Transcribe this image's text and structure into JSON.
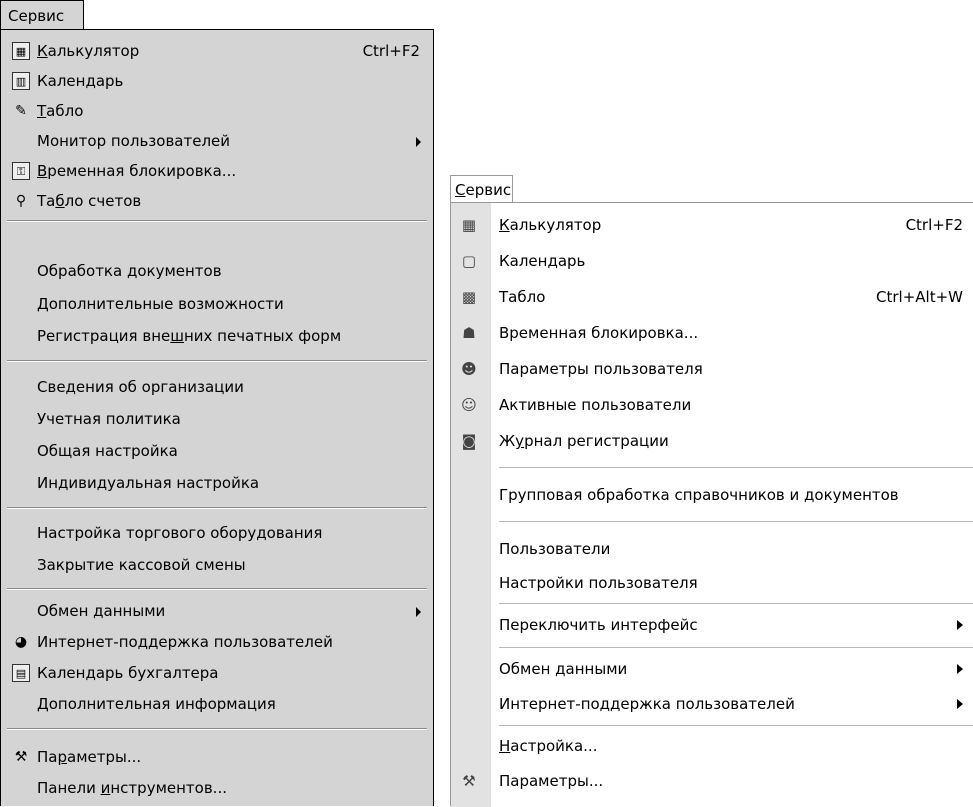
{
  "menu1": {
    "title": "Сервис",
    "items": [
      {
        "icon": "calculator-icon",
        "pre": "",
        "u": "К",
        "post": "алькулятор",
        "shortcut": "Ctrl+F2"
      },
      {
        "icon": "calendar-icon",
        "pre": "Кален",
        "u": "д",
        "post": "арь"
      },
      {
        "icon": "board-icon",
        "pre": "",
        "u": "Т",
        "post": "абло"
      },
      {
        "icon": "",
        "pre": "Монитор пользователей",
        "u": "",
        "post": "",
        "submenu": true
      },
      {
        "icon": "lock-icon",
        "pre": "",
        "u": "В",
        "post": "ременная блокировка..."
      },
      {
        "icon": "accounts-board-icon",
        "pre": "Та",
        "u": "б",
        "post": "ло счетов"
      },
      {
        "icon": "",
        "pre": "Обработка документов",
        "u": "",
        "post": ""
      },
      {
        "icon": "",
        "pre": "Дополнительные возможности",
        "u": "",
        "post": ""
      },
      {
        "icon": "",
        "pre": "Регистрация вне",
        "u": "ш",
        "post": "них печатных форм"
      },
      {
        "icon": "",
        "pre": "Сведения об организации",
        "u": "",
        "post": ""
      },
      {
        "icon": "",
        "pre": "Учетная политика",
        "u": "",
        "post": ""
      },
      {
        "icon": "",
        "pre": "Общая настройка",
        "u": "",
        "post": ""
      },
      {
        "icon": "",
        "pre": "Индивидуальная настройка",
        "u": "",
        "post": ""
      },
      {
        "icon": "",
        "pre": "Настройка торгового оборудования",
        "u": "",
        "post": ""
      },
      {
        "icon": "",
        "pre": "Закрытие кассовой смены",
        "u": "",
        "post": ""
      },
      {
        "icon": "",
        "pre": "Обмен данными",
        "u": "",
        "post": "",
        "submenu": true
      },
      {
        "icon": "internet-support-icon",
        "pre": "Интернет-поддержка пользователей",
        "u": "",
        "post": ""
      },
      {
        "icon": "accountant-calendar-icon",
        "pre": "Календарь бухгалтера",
        "u": "",
        "post": ""
      },
      {
        "icon": "",
        "pre": "Дополнительная информация",
        "u": "",
        "post": ""
      },
      {
        "icon": "tools-icon",
        "pre": "Па",
        "u": "р",
        "post": "аметры..."
      },
      {
        "icon": "",
        "pre": "Панели ",
        "u": "и",
        "post": "нструментов..."
      }
    ]
  },
  "menu2": {
    "title_u": "С",
    "title_rest": "ервис",
    "items": [
      {
        "icon": "calculator-icon",
        "pre": "",
        "u": "К",
        "post": "алькулятор",
        "shortcut": "Ctrl+F2"
      },
      {
        "icon": "calendar-icon",
        "pre": "Кален",
        "u": "д",
        "post": "арь"
      },
      {
        "icon": "board-icon",
        "pre": "Табло",
        "u": "",
        "post": "",
        "shortcut": "Ctrl+Alt+W"
      },
      {
        "icon": "lock-user-icon",
        "pre": "Временная блокировка...",
        "u": "",
        "post": ""
      },
      {
        "icon": "user-settings-icon",
        "pre": "Параметры пользователя",
        "u": "",
        "post": ""
      },
      {
        "icon": "active-users-icon",
        "pre": "Активные пользователи",
        "u": "",
        "post": ""
      },
      {
        "icon": "log-icon",
        "pre": "Ж",
        "u": "у",
        "post": "рнал регистрации"
      },
      {
        "icon": "",
        "pre": "Групповая обработка справочников и документов",
        "u": "",
        "post": ""
      },
      {
        "icon": "",
        "pre": "Пользователи",
        "u": "",
        "post": ""
      },
      {
        "icon": "",
        "pre": "Настройки пользователя",
        "u": "",
        "post": ""
      },
      {
        "icon": "",
        "pre": "Переключить интерфейс",
        "u": "",
        "post": "",
        "submenu": true
      },
      {
        "icon": "",
        "pre": "Обмен данными",
        "u": "",
        "post": "",
        "submenu": true
      },
      {
        "icon": "",
        "pre": "Интернет-поддержка пользователей",
        "u": "",
        "post": "",
        "submenu": true
      },
      {
        "icon": "",
        "pre": "",
        "u": "Н",
        "post": "астройка..."
      },
      {
        "icon": "tools-icon",
        "pre": "Параметры...",
        "u": "",
        "post": ""
      }
    ]
  }
}
